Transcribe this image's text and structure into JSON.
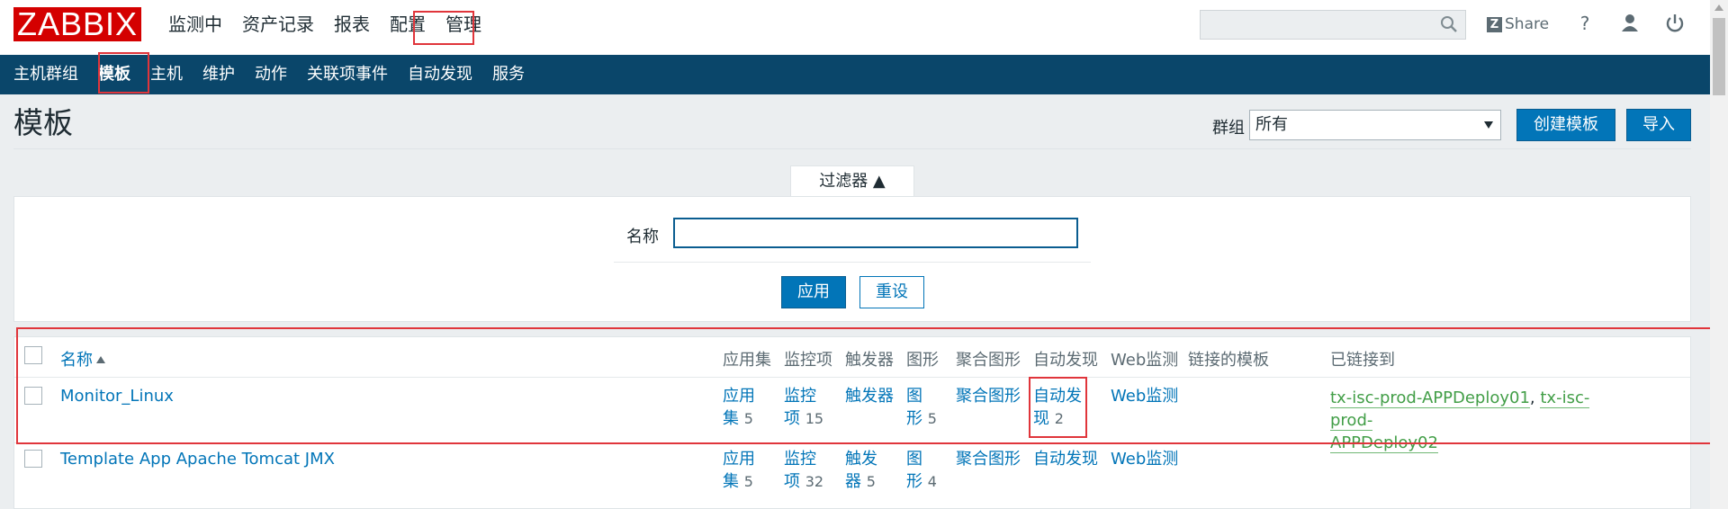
{
  "app": {
    "logo": "ZABBIX"
  },
  "main_menu": [
    {
      "label": "监测中"
    },
    {
      "label": "资产记录"
    },
    {
      "label": "报表"
    },
    {
      "label": "配置",
      "active": true
    },
    {
      "label": "管理"
    }
  ],
  "header": {
    "search_placeholder": "",
    "share_label": "Share",
    "share_glyph": "Z",
    "help_glyph": "?"
  },
  "sub_menu": [
    {
      "label": "主机群组"
    },
    {
      "label": "模板",
      "active": true
    },
    {
      "label": "主机"
    },
    {
      "label": "维护"
    },
    {
      "label": "动作"
    },
    {
      "label": "关联项事件"
    },
    {
      "label": "自动发现"
    },
    {
      "label": "服务"
    }
  ],
  "page": {
    "title": "模板",
    "group_label": "群组",
    "group_value": "所有",
    "create_button": "创建模板",
    "import_button": "导入"
  },
  "filter": {
    "tab_label": "过滤器 ▲",
    "name_label": "名称",
    "name_value": "",
    "apply_button": "应用",
    "reset_button": "重设"
  },
  "table": {
    "columns": {
      "name": "名称",
      "applications": "应用集",
      "items": "监控项",
      "triggers": "触发器",
      "graphs": "图形",
      "screens": "聚合图形",
      "discovery": "自动发现",
      "web": "Web监测",
      "linked_templates": "链接的模板",
      "linked_to": "已链接到"
    },
    "rows": [
      {
        "name": "Monitor_Linux",
        "app_l1": "应用",
        "app_l2": "集",
        "app_count": "5",
        "items_l1": "监控",
        "items_l2": "项",
        "items_count": "15",
        "triggers_l1": "触发器",
        "triggers_l2": "",
        "triggers_count": "",
        "graphs_l1": "图",
        "graphs_l2": "形",
        "graphs_count": "5",
        "screens": "聚合图形",
        "disc_l1": "自动发",
        "disc_l2": "现",
        "disc_count": "2",
        "web": "Web监测",
        "linked_1": "tx-isc-prod-APPDeploy01",
        "linked_sep": ", ",
        "linked_2a": "tx-isc-prod-",
        "linked_2b": "APPDeploy02"
      },
      {
        "name": "Template App Apache Tomcat JMX",
        "app_l1": "应用",
        "app_l2": "集",
        "app_count": "5",
        "items_l1": "监控",
        "items_l2": "项",
        "items_count": "32",
        "triggers_l1": "触发",
        "triggers_l2": "器",
        "triggers_count": "5",
        "graphs_l1": "图",
        "graphs_l2": "形",
        "graphs_count": "4",
        "screens": "聚合图形",
        "disc": "自动发现",
        "web": "Web监测"
      }
    ]
  },
  "colors": {
    "logo_red": "#d40000",
    "subnav_blue": "#0a466a",
    "link_blue": "#0275b8",
    "linked_green": "#429e47",
    "highlight_red": "#e0353b"
  }
}
